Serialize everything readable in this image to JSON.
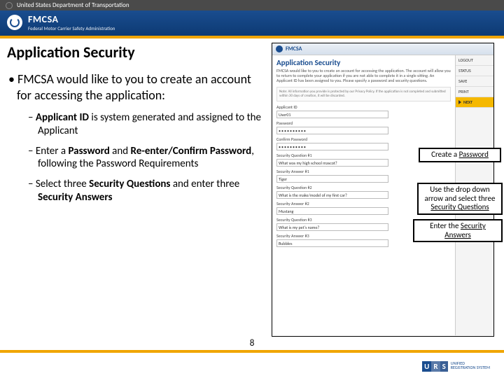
{
  "topbar": {
    "label": "United States Department of Transportation"
  },
  "banner": {
    "title": "FMCSA",
    "subtitle": "Federal Motor Carrier Safety Administration"
  },
  "slide": {
    "title": "Application Security",
    "main_bullet": "FMCSA would like to you to create an account for accessing the application:",
    "sub1_a": "Applicant ID",
    "sub1_b": " is system generated and assigned to the Applicant",
    "sub2_a": "Enter a ",
    "sub2_b": "Password",
    "sub2_c": " and ",
    "sub2_d": "Re-enter/Confirm Password",
    "sub2_e": ", following the Password Requirements",
    "sub3_a": "Select three ",
    "sub3_b": "Security Questions",
    "sub3_c": " and enter three ",
    "sub3_d": "Security Answers"
  },
  "callouts": {
    "c1_a": "Create a ",
    "c1_b": "Password",
    "c2_a": "Use the drop down arrow and select  three ",
    "c2_b": "Security Questions",
    "c3_a": "Enter the ",
    "c3_b": "Security Answers"
  },
  "screenshot": {
    "brand": "FMCSA",
    "heading": "Application Security",
    "intro": "FMCSA would like to you to create an account for accessing the application. The account will allow you to return to complete your application if you are not able to complete it in a single sitting. An Applicant ID has been assigned to you. Please specify a password and security questions.",
    "box_text": "Note: All information you provide is protected by our Privacy Policy. If the application is not completed and submitted within 30 days of creation, it will be discarded.",
    "applicant_label": "Applicant ID",
    "applicant_val": "User01",
    "password_label": "Password",
    "password_val": "••••••••••",
    "confirm_label": "Confirm Password",
    "confirm_val": "••••••••••",
    "sq1_label": "Security Question #1",
    "sq1_val": "What was my high school mascot?",
    "sa1_label": "Security Answer #1",
    "sa1_val": "Tiger",
    "sq2_label": "Security Question #2",
    "sq2_val": "What is the make/model of my first car?",
    "sa2_label": "Security Answer #2",
    "sa2_val": "Mustang",
    "sq3_label": "Security Question #3",
    "sq3_val": "What is my pet's name?",
    "sa3_label": "Security Answer #3",
    "sa3_val": "Bubbles",
    "side": {
      "logout": "LOGOUT",
      "status": "STATUS",
      "save": "SAVE",
      "print": "PRINT",
      "next": "NEXT"
    }
  },
  "page_number": "8",
  "urs": {
    "u": "U",
    "r": "R",
    "s": "S",
    "line1": "UNIFIED",
    "line2": "REGISTRATION SYSTEM"
  }
}
